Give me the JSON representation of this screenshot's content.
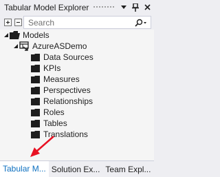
{
  "window": {
    "title": "Tabular Model Explorer"
  },
  "title_buttons": {
    "dropdown_icon": "chevron-down-icon",
    "pin_icon": "pin-icon",
    "close_icon": "close-icon"
  },
  "toolbar": {
    "expand_icon": "expand-all-icon",
    "collapse_icon": "collapse-all-icon"
  },
  "search": {
    "placeholder": "Search"
  },
  "tree": {
    "root": {
      "label": "Models",
      "icon": "folder-open-icon"
    },
    "model": {
      "label": "AzureASDemo",
      "icon": "tabular-model-icon"
    },
    "children": [
      {
        "label": "Data Sources",
        "icon": "folder-icon"
      },
      {
        "label": "KPIs",
        "icon": "folder-icon"
      },
      {
        "label": "Measures",
        "icon": "folder-icon"
      },
      {
        "label": "Perspectives",
        "icon": "folder-icon"
      },
      {
        "label": "Relationships",
        "icon": "folder-icon"
      },
      {
        "label": "Roles",
        "icon": "folder-icon"
      },
      {
        "label": "Tables",
        "icon": "folder-icon"
      },
      {
        "label": "Translations",
        "icon": "folder-icon"
      }
    ]
  },
  "tabs": [
    {
      "label": "Tabular M...",
      "active": true
    },
    {
      "label": "Solution Ex..."
    },
    {
      "label": "Team Expl..."
    }
  ],
  "colors": {
    "accent": "#0e70c0",
    "annotation_arrow": "#e81123"
  }
}
